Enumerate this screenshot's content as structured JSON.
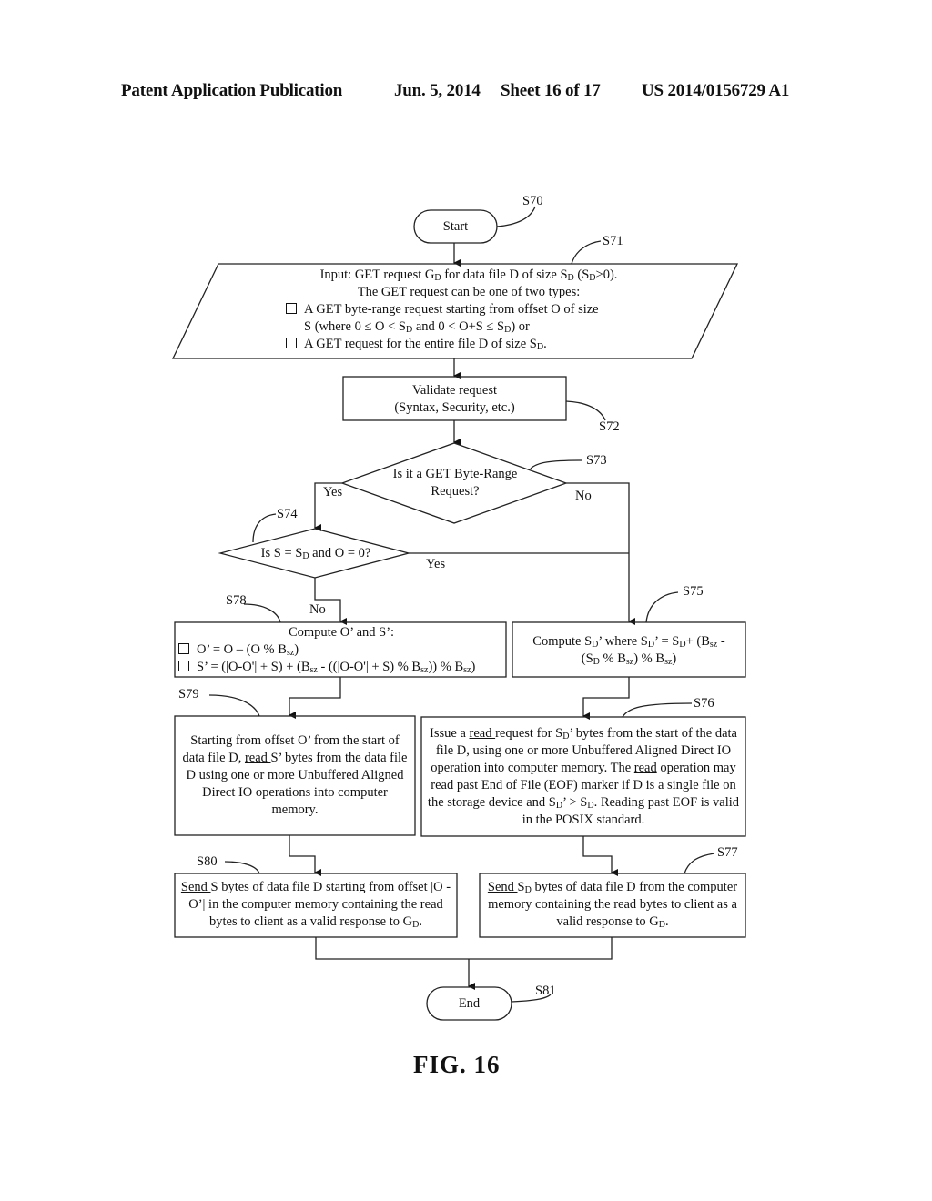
{
  "header": {
    "publication": "Patent Application Publication",
    "date": "Jun. 5, 2014",
    "sheet": "Sheet 16 of 17",
    "number": "US 2014/0156729 A1"
  },
  "figure_label": "FIG. 16",
  "steps": {
    "s70": {
      "ref": "S70",
      "text": "Start"
    },
    "s71": {
      "ref": "S71",
      "line1_a": "Input: GET request G",
      "line1_sub1": "D",
      "line1_b": " for data file D of size S",
      "line1_sub2": "D",
      "line1_c": " (S",
      "line1_sub3": "D",
      "line1_d": ">0).",
      "line2": "The GET request can be one of two types:",
      "bullet1_a": "A GET byte-range request starting from offset O of size",
      "bullet1_b": "S (where 0 ≤ O < S",
      "bullet1_sub1": "D",
      "bullet1_c": " and 0 < O+S ≤ S",
      "bullet1_sub2": "D",
      "bullet1_d": ") or",
      "bullet2_a": "A GET request for the entire file D of size S",
      "bullet2_sub": "D",
      "bullet2_b": "."
    },
    "s72": {
      "ref": "S72",
      "line1": "Validate request",
      "line2": "(Syntax, Security, etc.)"
    },
    "s73": {
      "ref": "S73",
      "line1": "Is it a GET Byte-Range",
      "line2": "Request?",
      "yes": "Yes",
      "no": "No"
    },
    "s74": {
      "ref": "S74",
      "text_a": "Is S = S",
      "text_sub": "D",
      "text_b": " and O = 0?",
      "yes": "Yes",
      "no": "No"
    },
    "s75": {
      "ref": "S75",
      "a": "Compute S",
      "s1": "D",
      "b": "’ where S",
      "s2": "D",
      "c": "’ = S",
      "s3": "D",
      "d": "+ (B",
      "s4": "sz",
      "e": " -",
      "f": "(S",
      "s5": "D",
      "g": " % B",
      "s6": "sz",
      "h": ") % B",
      "s7": "sz",
      "i": ")"
    },
    "s76": {
      "ref": "S76",
      "a": "Issue a ",
      "read1": "read ",
      "b": "request for S",
      "s1": "D",
      "c": "’ bytes from the start of the data file D, using one or more Unbuffered Aligned Direct IO operation into computer memory. The ",
      "read2": "read",
      "d": " operation may read past End of File (EOF) marker if D is a single file on the storage device and S",
      "s2": "D",
      "e": "’ > S",
      "s3": "D",
      "f": ". Reading past EOF is valid in the POSIX standard."
    },
    "s77": {
      "ref": "S77",
      "send": "Send ",
      "a": "S",
      "s1": "D",
      "b": " bytes of data file D from the computer memory containing the read bytes to client as a valid response to G",
      "s2": "D",
      "c": "."
    },
    "s78": {
      "ref": "S78",
      "title": "Compute O’ and S’:",
      "f1_a": "O’ = O – (O % B",
      "f1_sub": "sz",
      "f1_b": ")",
      "f2_a": "S’ = (|O-O'| + S) + (B",
      "f2_sub1": "sz",
      "f2_b": " - ((|O-O'| + S) % B",
      "f2_sub2": "sz",
      "f2_c": ")) % B",
      "f2_sub3": "sz",
      "f2_d": ")"
    },
    "s79": {
      "ref": "S79",
      "a": "Starting from offset O’ from the start of data file D, ",
      "read": "read ",
      "b": "S’ bytes from the data file D using one or more Unbuffered Aligned Direct IO operations into computer memory."
    },
    "s80": {
      "ref": "S80",
      "send": "Send ",
      "a": "S bytes of data file D starting from offset |O - O’| in the computer memory containing the read bytes to client as a valid response to G",
      "s1": "D",
      "b": "."
    },
    "s81": {
      "ref": "S81",
      "text": "End"
    }
  }
}
